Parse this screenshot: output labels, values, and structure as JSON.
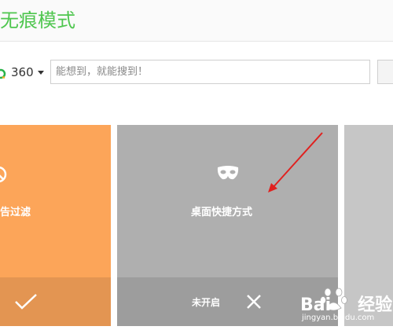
{
  "page": {
    "title": "无痕模式"
  },
  "search": {
    "engine_label": "360",
    "placeholder": "能想到，就能搜到！"
  },
  "cards": {
    "ad_filter": {
      "label": "告过滤",
      "status_icon": "check-icon"
    },
    "desktop_shortcut": {
      "label": "桌面快捷方式",
      "icon": "mask-icon",
      "status_label": "未开启",
      "status_icon": "close-icon"
    }
  },
  "watermark": {
    "brand": "Bai",
    "brand_suffix": "经验",
    "url": "jingyan.baidu.com"
  },
  "colors": {
    "title_green": "#4fc64f",
    "orange_card": "#fca559",
    "orange_footer": "#e39552",
    "gray_card": "#afafaf",
    "gray_footer": "#9d9d9d",
    "annotation_arrow": "#e0211f"
  }
}
